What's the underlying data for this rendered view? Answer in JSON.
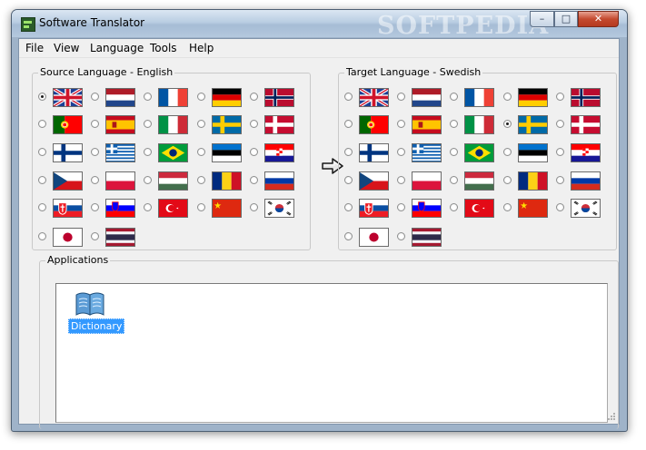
{
  "window": {
    "title": "Software Translator",
    "watermark": "SOFTPEDIA",
    "controls": {
      "minimize": "–",
      "maximize": "□",
      "close": "✕"
    }
  },
  "menu": [
    "File",
    "View",
    "Language",
    "Tools",
    "Help"
  ],
  "source": {
    "title": "Source Language - English",
    "flags": [
      "uk",
      "netherlands",
      "france",
      "germany",
      "norway",
      "portugal",
      "spain",
      "italy",
      "sweden",
      "denmark",
      "finland",
      "greece",
      "brazil",
      "estonia",
      "croatia",
      "czech",
      "poland",
      "hungary",
      "romania",
      "russia",
      "slovakia",
      "slovenia",
      "turkey",
      "china",
      "korea",
      "japan",
      "thailand"
    ],
    "selected": "uk"
  },
  "target": {
    "title": "Target Language - Swedish",
    "flags": [
      "uk",
      "netherlands",
      "france",
      "germany",
      "norway",
      "portugal",
      "spain",
      "italy",
      "sweden",
      "denmark",
      "finland",
      "greece",
      "brazil",
      "estonia",
      "croatia",
      "czech",
      "poland",
      "hungary",
      "romania",
      "russia",
      "slovakia",
      "slovenia",
      "turkey",
      "china",
      "korea",
      "japan",
      "thailand"
    ],
    "selected": "sweden"
  },
  "swap_icon": "right-arrow-icon",
  "applications": {
    "title": "Applications",
    "items": [
      {
        "label": "Dictionary",
        "icon": "book-icon",
        "selected": true
      }
    ]
  },
  "colors": {
    "selection": "#3399ff",
    "window_frame": "#9fb3c9",
    "close_button": "#c44a2f"
  }
}
